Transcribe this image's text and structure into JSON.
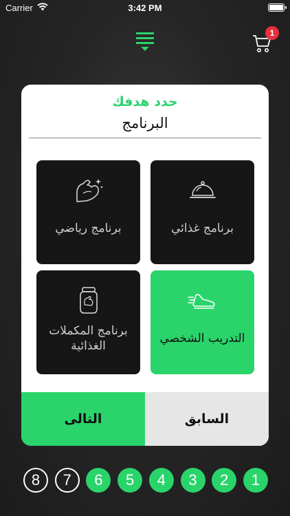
{
  "status_bar": {
    "carrier": "Carrier",
    "time": "3:42 PM"
  },
  "header": {
    "cart_count": "1"
  },
  "card": {
    "title": "حدد هدفك",
    "subtitle": "البرنامج",
    "options": {
      "food": {
        "label": "برنامج غذائي",
        "icon": "food-cloche-icon"
      },
      "sport": {
        "label": "برنامج رياضي",
        "icon": "flexed-arm-icon"
      },
      "personal": {
        "label": "التدريب الشخصي",
        "icon": "running-shoe-icon",
        "selected": true
      },
      "supplements": {
        "label": "برنامج المكملات الغذائية",
        "icon": "supplement-jar-icon"
      }
    },
    "buttons": {
      "next": "التالى",
      "previous": "السابق"
    }
  },
  "steps": {
    "items": [
      "8",
      "7",
      "6",
      "5",
      "4",
      "3",
      "2",
      "1"
    ],
    "completed": 6,
    "total": 8
  },
  "colors": {
    "accent": "#2ad46b",
    "badge": "#e8303d",
    "tile_dark": "#161616",
    "prev_button": "#e6e6e6"
  }
}
